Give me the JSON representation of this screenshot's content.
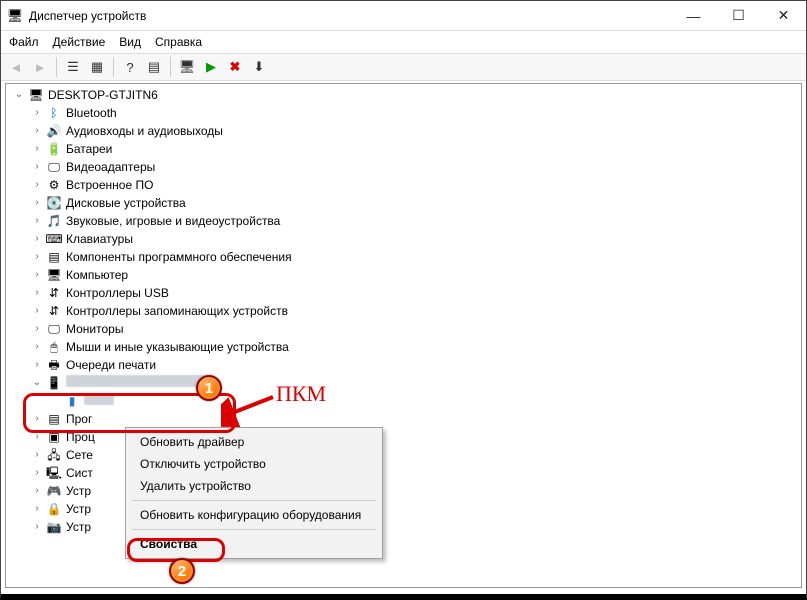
{
  "titlebar": {
    "title": "Диспетчер устройств"
  },
  "menu": {
    "file": "Файл",
    "action": "Действие",
    "view": "Вид",
    "help": "Справка"
  },
  "tree": {
    "root": "DESKTOP-GTJITN6",
    "categories": [
      "Bluetooth",
      "Аудиовходы и аудиовыходы",
      "Батареи",
      "Видеоадаптеры",
      "Встроенное ПО",
      "Дисковые устройства",
      "Звуковые, игровые и видеоустройства",
      "Клавиатуры",
      "Компоненты программного обеспечения",
      "Компьютер",
      "Контроллеры USB",
      "Контроллеры запоминающих устройств",
      "Мониторы",
      "Мыши и иные указывающие устройства",
      "Очереди печати"
    ],
    "portable_label_obscured": "Переносные устройства",
    "below": [
      "Программные устройства",
      "Процессоры",
      "Сетевые адаптеры",
      "Системные устройства",
      "Устройства HID",
      "Устройства безопасности",
      "Устройства обработки изображений"
    ],
    "below_short": [
      "Прог",
      "Проц",
      "Сете",
      "Сист",
      "Устр",
      "Устр",
      "Устр"
    ]
  },
  "context_menu": {
    "update_driver": "Обновить драйвер",
    "disable_device": "Отключить устройство",
    "delete_device": "Удалить устройство",
    "scan_hw": "Обновить конфигурацию оборудования",
    "properties": "Свойства"
  },
  "annotations": {
    "badge1": "1",
    "badge2": "2",
    "rmb_label": "ПКМ"
  },
  "icons": {
    "app": "🖥",
    "computer": "🖥",
    "bluetooth": "ᛒ",
    "audio": "🔊",
    "battery": "🔋",
    "video": "🖵",
    "firmware": "⚙",
    "disk": "💽",
    "sound": "🎵",
    "keyboard": "⌨",
    "software": "▤",
    "pc": "🖥",
    "usb": "⇵",
    "storage": "⇵",
    "monitor": "🖵",
    "mouse": "🖱",
    "printer": "🖶",
    "portable": "📱",
    "cpu": "▣",
    "net": "🖧",
    "system": "🖳",
    "hid": "🎮",
    "security": "🔒",
    "imaging": "📷"
  }
}
